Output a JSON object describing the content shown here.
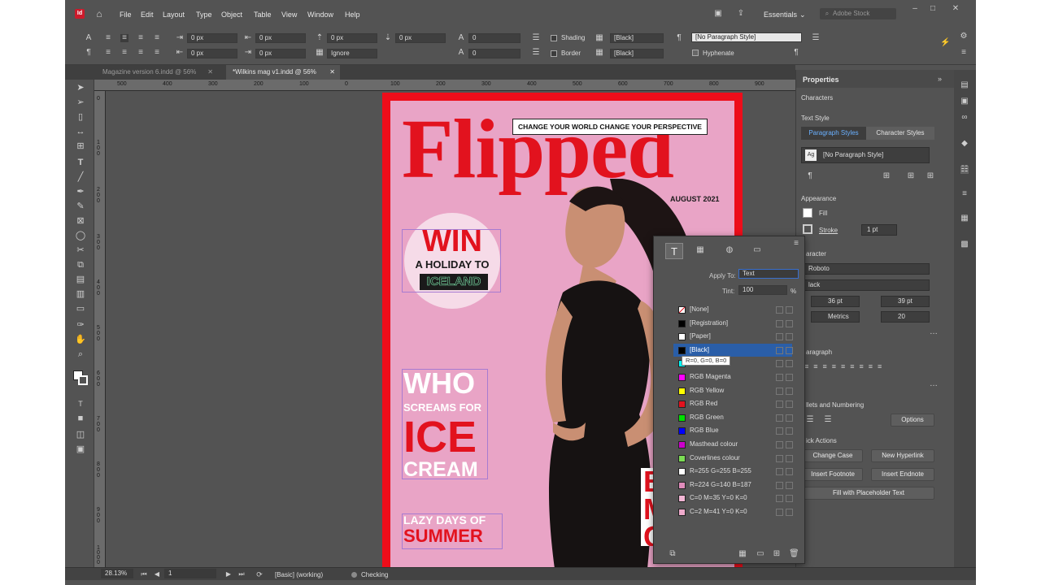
{
  "menubar": {
    "items": [
      "File",
      "Edit",
      "Layout",
      "Type",
      "Object",
      "Table",
      "View",
      "Window",
      "Help"
    ],
    "workspace": "Essentials",
    "search_placeholder": "Adobe Stock"
  },
  "control_bar": {
    "indent_left": "0 px",
    "indent_right": "0 px",
    "first_line_indent": "0 px",
    "last_line_indent": "0 px",
    "space_before": "0 px",
    "space_after": "0 px",
    "drop_cap_lines": "0",
    "drop_cap_chars": "0",
    "align_to_grid": "Ignore",
    "shading_label": "Shading",
    "border_label": "Border",
    "shading_color": "[Black]",
    "border_color": "[Black]",
    "paragraph_style": "[No Paragraph Style]",
    "hyphenate_label": "Hyphenate"
  },
  "tabs": [
    {
      "label": "Magazine version 6.indd @ 56%",
      "active": false
    },
    {
      "label": "*Wilkins mag v1.indd @ 56%",
      "active": true
    }
  ],
  "rulers": {
    "h": [
      "500",
      "400",
      "300",
      "200",
      "100",
      "0",
      "100",
      "200",
      "300",
      "400",
      "500",
      "600",
      "700",
      "800",
      "900"
    ],
    "v": [
      "0",
      "1 0 0",
      "2 0 0",
      "3 0 0",
      "4 0 0",
      "5 0 0",
      "6 0 0",
      "7 0 0",
      "8 0 0",
      "9 0 0",
      "1 0 0 0"
    ]
  },
  "cover": {
    "masthead": "Flipped",
    "tagline": "CHANGE YOUR WORLD CHANGE YOUR PERSPECTIVE",
    "date": "AUGUST 2021",
    "win": "WIN",
    "holiday": "A HOLIDAY TO",
    "iceland": "ICELAND",
    "who": "WHO",
    "screams": "SCREAMS FOR",
    "ice": "ICE",
    "cream": "CREAM",
    "lazy": "LAZY DAYS OF",
    "summer": "SUMMER",
    "best1": "BES",
    "best2": "MU",
    "best3": "CAK"
  },
  "properties": {
    "title": "Properties",
    "context": "Characters",
    "text_style_label": "Text Style",
    "tab_paragraph": "Paragraph Styles",
    "tab_character": "Character Styles",
    "style_value": "[No Paragraph Style]",
    "appearance_label": "Appearance",
    "fill_label": "Fill",
    "stroke_label": "Stroke",
    "stroke_weight": "1 pt",
    "character_label": "aracter",
    "font": "Roboto",
    "font_style": "lack",
    "font_size": "36 pt",
    "leading": "39 pt",
    "kerning": "Metrics",
    "tracking": "20",
    "paragraph_label": "aragraph",
    "bullets_label": "llets and Numbering",
    "options_button": "Options",
    "quick_actions_label": "ick Actions",
    "change_case": "Change Case",
    "new_hyperlink": "New Hyperlink",
    "insert_footnote": "Insert Footnote",
    "insert_endnote": "Insert Endnote",
    "fill_placeholder": "Fill with Placeholder Text"
  },
  "swatches": {
    "apply_to_label": "Apply To:",
    "apply_to_value": "Text",
    "tint_label": "Tint:",
    "tint_value": "100",
    "tint_unit": "%",
    "tooltip": "R=0, G=0, B=0",
    "items": [
      {
        "name": "[None]",
        "color": "#ffffff"
      },
      {
        "name": "[Registration]",
        "color": "#000000"
      },
      {
        "name": "[Paper]",
        "color": "#ffffff"
      },
      {
        "name": "[Black]",
        "color": "#000000"
      },
      {
        "name": "",
        "color": "#00ffff"
      },
      {
        "name": "RGB Magenta",
        "color": "#ff00ff"
      },
      {
        "name": "RGB Yellow",
        "color": "#ffff00"
      },
      {
        "name": "RGB Red",
        "color": "#e2121e"
      },
      {
        "name": "RGB Green",
        "color": "#00e000"
      },
      {
        "name": "RGB Blue",
        "color": "#0000ff"
      },
      {
        "name": "Masthead colour",
        "color": "#cc00cc"
      },
      {
        "name": "Coverlines colour",
        "color": "#7bdc54"
      },
      {
        "name": "R=255 G=255 B=255",
        "color": "#ffffff"
      },
      {
        "name": "R=224 G=140 B=187",
        "color": "#e08cbb"
      },
      {
        "name": "C=0 M=35 Y=0 K=0",
        "color": "#f3b6d5"
      },
      {
        "name": "C=2 M=41 Y=0 K=0",
        "color": "#eeaacb"
      }
    ]
  },
  "status": {
    "zoom": "28.13%",
    "page": "1",
    "preflight_profile": "[Basic] (working)",
    "preflight_status": "Checking"
  }
}
